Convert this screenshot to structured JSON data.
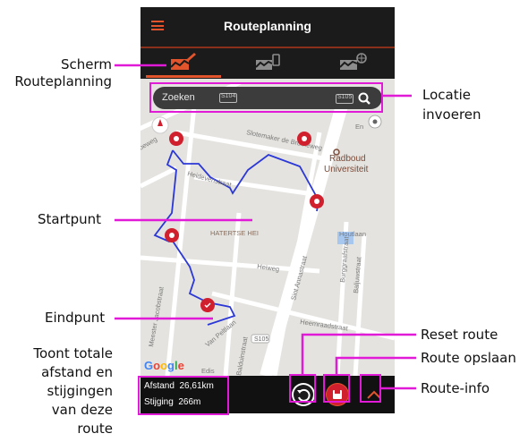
{
  "header": {
    "title": "Routeplanning",
    "menu_icon": "hamburger-menu-icon"
  },
  "tabs": [
    {
      "icon": "route-edit-icon",
      "active": true
    },
    {
      "icon": "route-phone-icon",
      "active": false
    },
    {
      "icon": "route-globe-icon",
      "active": false
    }
  ],
  "search": {
    "placeholder": "Zoeken"
  },
  "map": {
    "labels": [
      "S104",
      "S105",
      "Slotemaker de Bruïneweg",
      "Heidevenstraat",
      "Radboud",
      "Universiteit",
      "HATERTSE HEI",
      "Houtlaan",
      "Heiweg",
      "Sint Annastraat",
      "Burggraafstraat",
      "Baljuwstraat",
      "Heemraadstraat",
      "Meester Jacobstraat",
      "Van Peltlaan",
      "Balduinstraat",
      "S105",
      "Edis",
      "En"
    ],
    "google": "Google",
    "route_color": "#2b37d6"
  },
  "stats": {
    "distance_label": "Afstand",
    "distance_value": "26,61km",
    "climb_label": "Stijging",
    "climb_value": "266m"
  },
  "buttons": {
    "reset_icon": "undo-icon",
    "save_icon": "save-icon",
    "info_icon": "chevron-up-icon"
  },
  "callouts": {
    "screen_1": "Scherm",
    "screen_2": "Routeplanning",
    "location_1": "Locatie",
    "location_2": "invoeren",
    "start": "Startpunt",
    "end": "Eindpunt",
    "total_1": "Toont totale",
    "total_2": "afstand en",
    "total_3": "stijgingen",
    "total_4": "van deze",
    "total_5": "route",
    "reset": "Reset route",
    "save": "Route opslaan",
    "info": "Route-info"
  },
  "colors": {
    "accent": "#e2552c",
    "callout_line": "#e11ad8",
    "bar": "#1b1b1b",
    "marker": "#d0202e"
  }
}
